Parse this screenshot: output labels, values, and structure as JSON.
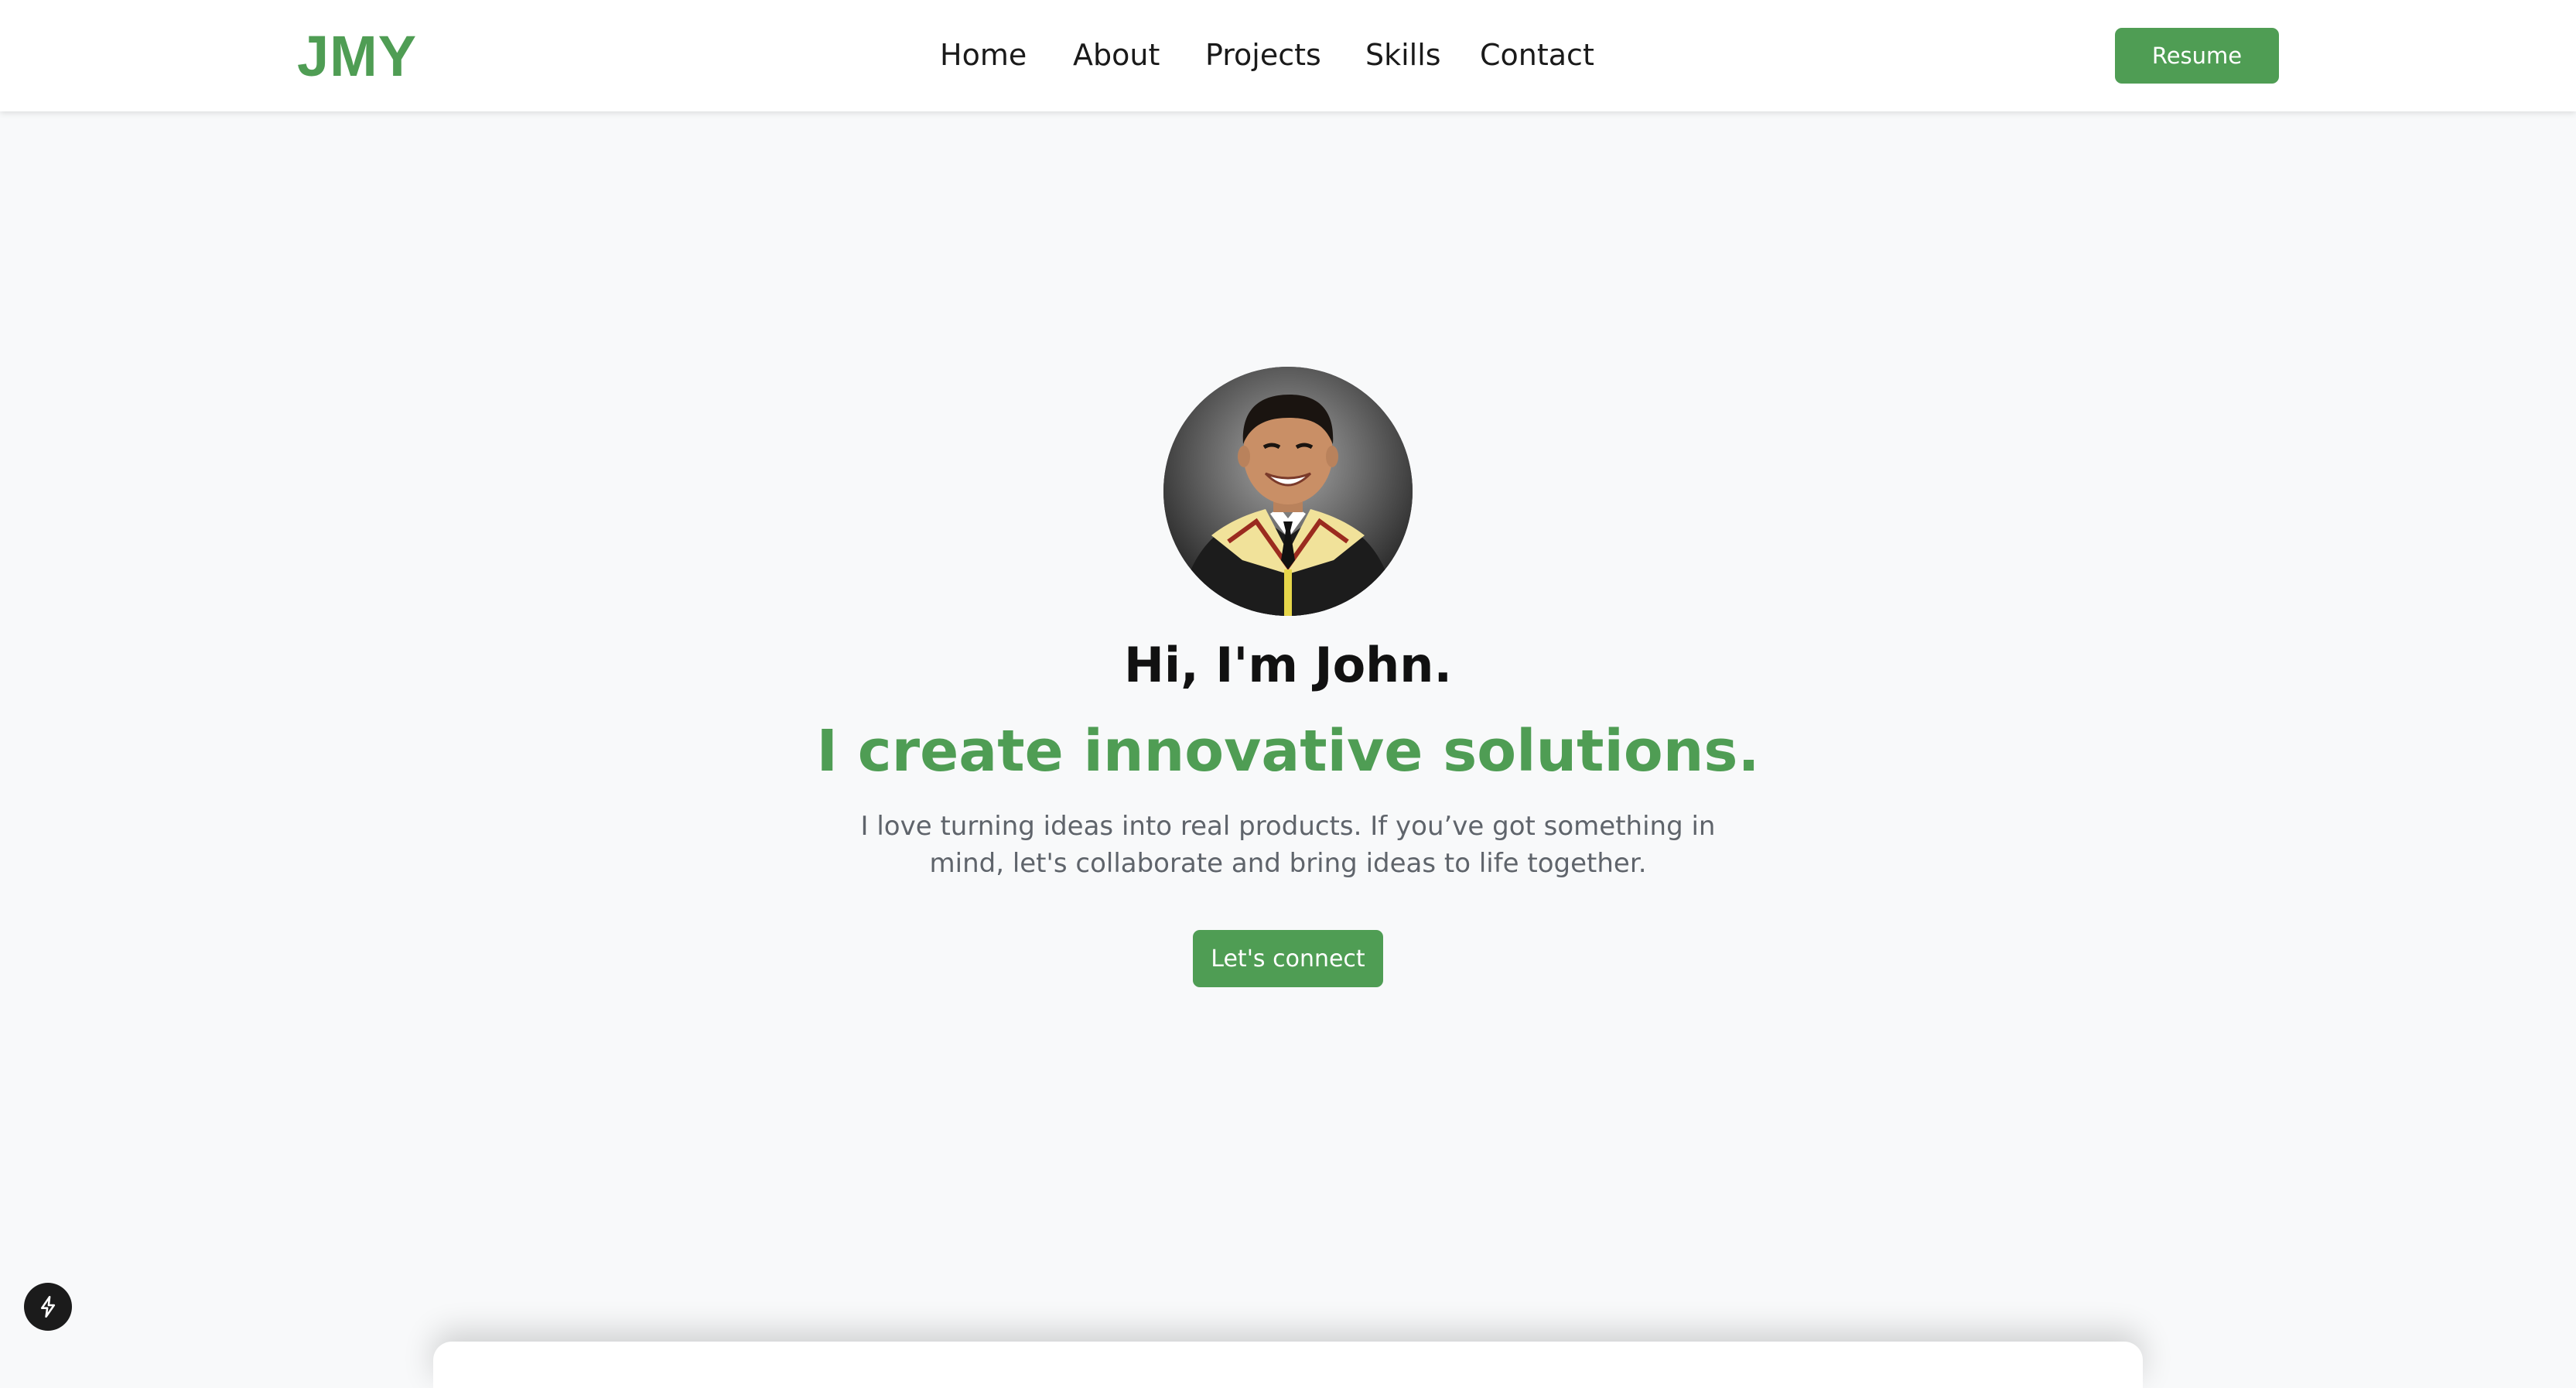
{
  "header": {
    "logo": "JMY",
    "nav": [
      {
        "label": "Home"
      },
      {
        "label": "About"
      },
      {
        "label": "Projects"
      },
      {
        "label": "Skills"
      },
      {
        "label": "Contact"
      }
    ],
    "resume_label": "Resume"
  },
  "hero": {
    "avatar_icon": "profile-photo",
    "greeting": "Hi, I'm John.",
    "tagline": "I create innovative solutions.",
    "description": "I love turning ideas into real products. If you’ve got something in mind, let's collaborate and bring ideas to life together.",
    "cta_label": "Let's connect"
  },
  "dev_badge": {
    "icon": "lightning-icon"
  },
  "colors": {
    "accent": "#4f9d54",
    "background": "#f8f9fa",
    "header_bg": "#ffffff",
    "text_dark": "#111111",
    "text_muted": "#5f646b"
  }
}
